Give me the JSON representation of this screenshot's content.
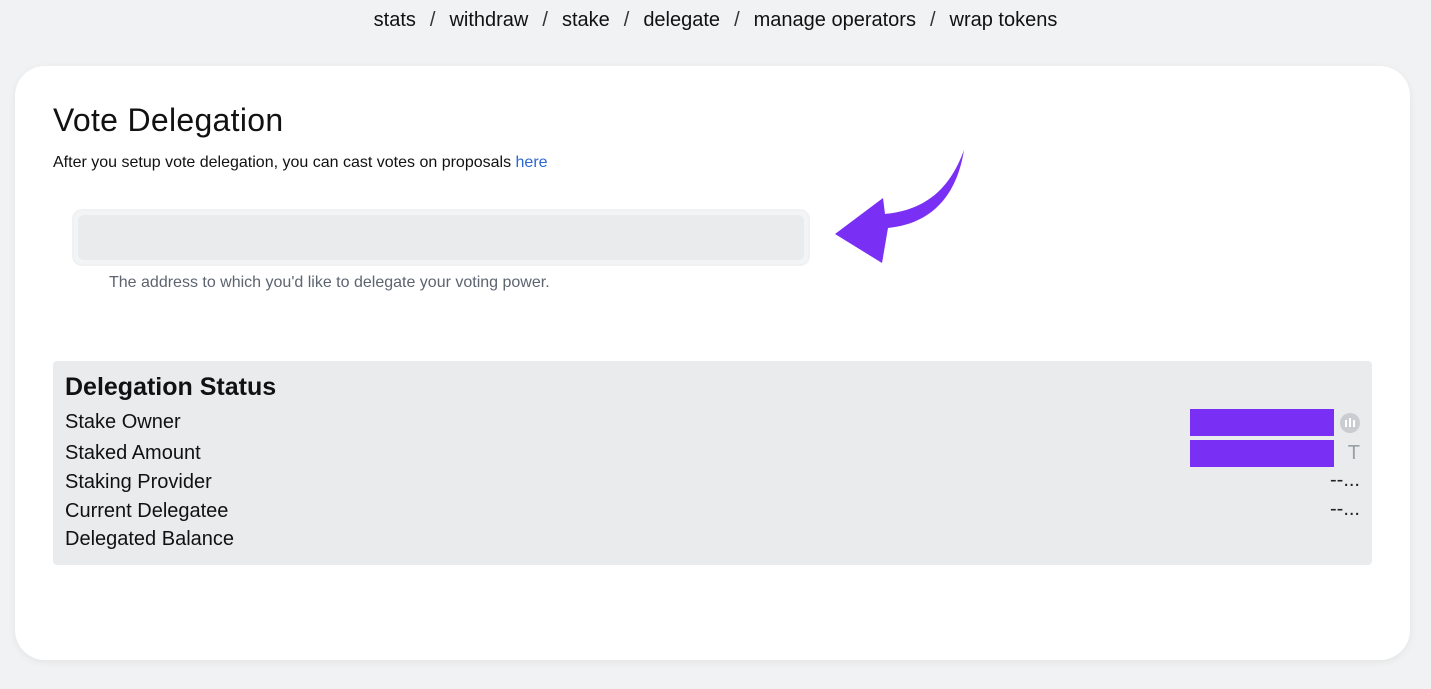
{
  "nav": {
    "items": [
      "stats",
      "withdraw",
      "stake",
      "delegate",
      "manage operators",
      "wrap tokens"
    ],
    "separator": "/"
  },
  "page": {
    "title": "Vote Delegation",
    "subtitle": "After you setup vote delegation, you can cast votes on proposals",
    "subtitle_link": "here",
    "address_input": {
      "value": "",
      "placeholder": ""
    },
    "address_helper": "The address to which you'd like to delegate your voting power."
  },
  "status": {
    "title": "Delegation Status",
    "rows": [
      {
        "label": "Stake Owner",
        "value_suffix_icon": "coin-icon"
      },
      {
        "label": "Staked Amount",
        "value_suffix": "T"
      },
      {
        "label": "Staking Provider",
        "value": "--..."
      },
      {
        "label": "Current Delegatee",
        "value": "--..."
      },
      {
        "label": "Delegated Balance",
        "value": ""
      }
    ]
  },
  "colors": {
    "accent": "#7a2ff5",
    "link": "#2b67d6",
    "panel": "#e9ebed"
  }
}
